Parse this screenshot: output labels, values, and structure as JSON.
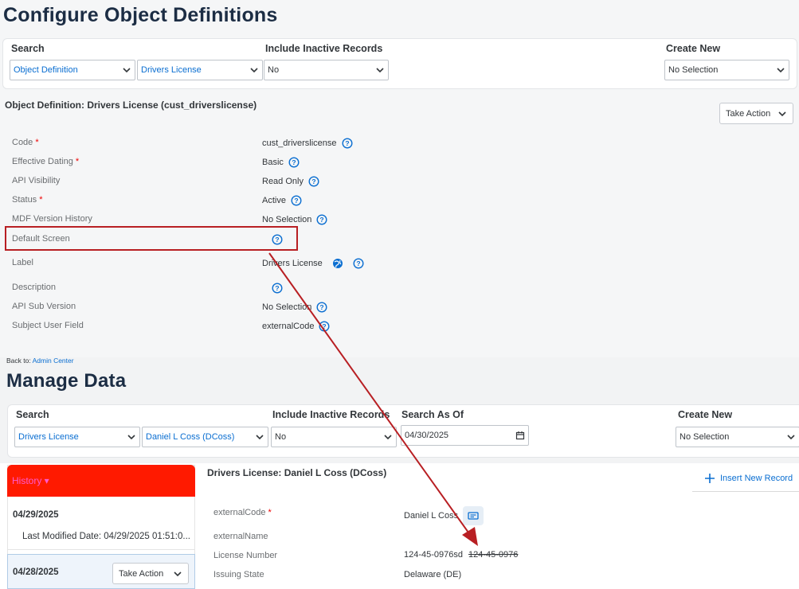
{
  "config": {
    "title": "Configure Object Definitions",
    "search_label": "Search",
    "object_type_value": "Object Definition",
    "object_value": "Drivers License",
    "inactive_label": "Include Inactive Records",
    "inactive_value": "No",
    "create_label": "Create New",
    "create_value": "No Selection",
    "object_header": "Object Definition: Drivers License (cust_driverslicense)",
    "take_action": "Take Action",
    "fields": [
      {
        "label": "Code",
        "required": "*",
        "value": "cust_driverslicense"
      },
      {
        "label": "Effective Dating",
        "required": "*",
        "value": "Basic"
      },
      {
        "label": "API Visibility",
        "required": "",
        "value": "Read Only"
      },
      {
        "label": "Status",
        "required": "*",
        "value": "Active"
      },
      {
        "label": "MDF Version History",
        "required": "",
        "value": "No Selection"
      },
      {
        "label": "Default Screen",
        "required": "",
        "value": ""
      },
      {
        "label": "Label",
        "required": "",
        "value": "Drivers License"
      },
      {
        "label": "Description",
        "required": "",
        "value": ""
      },
      {
        "label": "API Sub Version",
        "required": "",
        "value": "No Selection"
      },
      {
        "label": "Subject User Field",
        "required": "",
        "value": "externalCode"
      }
    ]
  },
  "manage": {
    "back_prefix": "Back to: ",
    "back_link": "Admin Center",
    "title": "Manage Data",
    "search_label": "Search",
    "object_value": "Drivers License",
    "person_value": "Daniel L Coss (DCoss)",
    "inactive_label": "Include Inactive Records",
    "inactive_value": "No",
    "asof_label": "Search As Of",
    "asof_value": "04/30/2025",
    "create_label": "Create New",
    "create_value": "No Selection",
    "history_title": "History ▾",
    "history": [
      {
        "date": "04/29/2025",
        "sub": "Last Modified Date: 04/29/2025 01:51:0..."
      },
      {
        "date": "04/28/2025",
        "action": "Take Action"
      }
    ],
    "record_header": "Drivers License: Daniel L Coss (DCoss)",
    "insert_label": "Insert New Record",
    "record_fields": [
      {
        "label": "externalCode",
        "required": "*",
        "value": "Daniel L Coss"
      },
      {
        "label": "externalName",
        "required": "",
        "value": ""
      },
      {
        "label": "License Number",
        "required": "",
        "value": "124-45-0976sd",
        "old_value": "124-45-0976"
      },
      {
        "label": "Issuing State",
        "required": "",
        "value": "Delaware (DE)"
      }
    ]
  },
  "colors": {
    "accent": "#0a6ed1",
    "annotation": "#b81f23",
    "history_header": "#ff1a00",
    "history_title": "#ff5ad0"
  }
}
